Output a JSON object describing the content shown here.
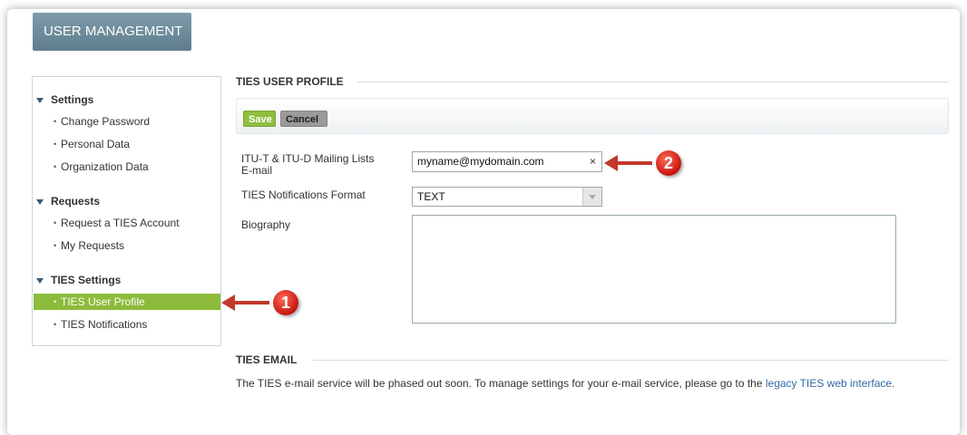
{
  "header": {
    "title": "USER MANAGEMENT"
  },
  "sidebar": {
    "groups": [
      {
        "label": "Settings",
        "items": [
          "Change Password",
          "Personal Data",
          "Organization Data"
        ]
      },
      {
        "label": "Requests",
        "items": [
          "Request a TIES Account",
          "My Requests"
        ]
      },
      {
        "label": "TIES Settings",
        "items": [
          "TIES User Profile",
          "TIES Notifications"
        ]
      }
    ],
    "active_item": "TIES User Profile"
  },
  "profile": {
    "section_title": "TIES USER PROFILE",
    "save_label": "Save",
    "cancel_label": "Cancel",
    "email_label_line1": "ITU-T & ITU-D Mailing Lists",
    "email_label_line2": "E-mail",
    "email_value": "myname@mydomain.com",
    "email_clear": "×",
    "format_label": "TIES Notifications Format",
    "format_value": "TEXT",
    "bio_label": "Biography",
    "bio_value": ""
  },
  "email_section": {
    "title": "TIES EMAIL",
    "text": "The TIES e-mail service will be phased out soon. To manage settings for your e-mail service, please go to the ",
    "link": "legacy TIES web interface",
    "suffix": "."
  },
  "annotations": {
    "badge1": "1",
    "badge2": "2"
  },
  "colors": {
    "accent_green": "#8dbb3b",
    "header_blue": "#6a8897",
    "annotation_red": "#c0392b"
  }
}
